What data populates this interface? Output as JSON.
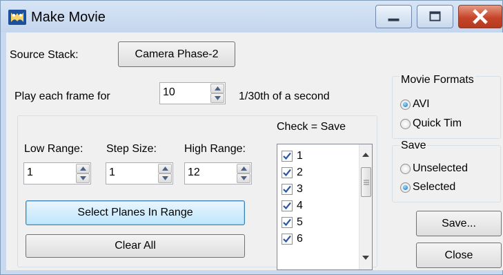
{
  "window": {
    "title": "Make Movie",
    "icon": "movie-app-icon",
    "controls": [
      "minimize-icon",
      "maximize-icon",
      "close-icon"
    ],
    "close_color": "#c6452a"
  },
  "source": {
    "label": "Source Stack:",
    "button": "Camera Phase-2"
  },
  "play": {
    "label": "Play each frame for",
    "value": "10",
    "unit": "1/30th of a second"
  },
  "ranges": {
    "low_label": "Low Range:",
    "low_value": "1",
    "step_label": "Step Size:",
    "step_value": "1",
    "high_label": "High Range:",
    "high_value": "12"
  },
  "buttons": {
    "select_planes": "Select Planes In Range",
    "clear_all": "Clear All",
    "save": "Save...",
    "close": "Close"
  },
  "checklist": {
    "header": "Check = Save",
    "items": [
      {
        "label": "1",
        "checked": true
      },
      {
        "label": "2",
        "checked": true
      },
      {
        "label": "3",
        "checked": true
      },
      {
        "label": "4",
        "checked": true
      },
      {
        "label": "5",
        "checked": true
      },
      {
        "label": "6",
        "checked": true
      }
    ]
  },
  "movie_formats": {
    "title": "Movie Formats",
    "options": [
      {
        "label": "AVI",
        "selected": true
      },
      {
        "label": "Quick Tim",
        "selected": false
      }
    ]
  },
  "save_group": {
    "title": "Save",
    "options": [
      {
        "label": "Unselected",
        "selected": false
      },
      {
        "label": "Selected",
        "selected": true
      }
    ]
  }
}
